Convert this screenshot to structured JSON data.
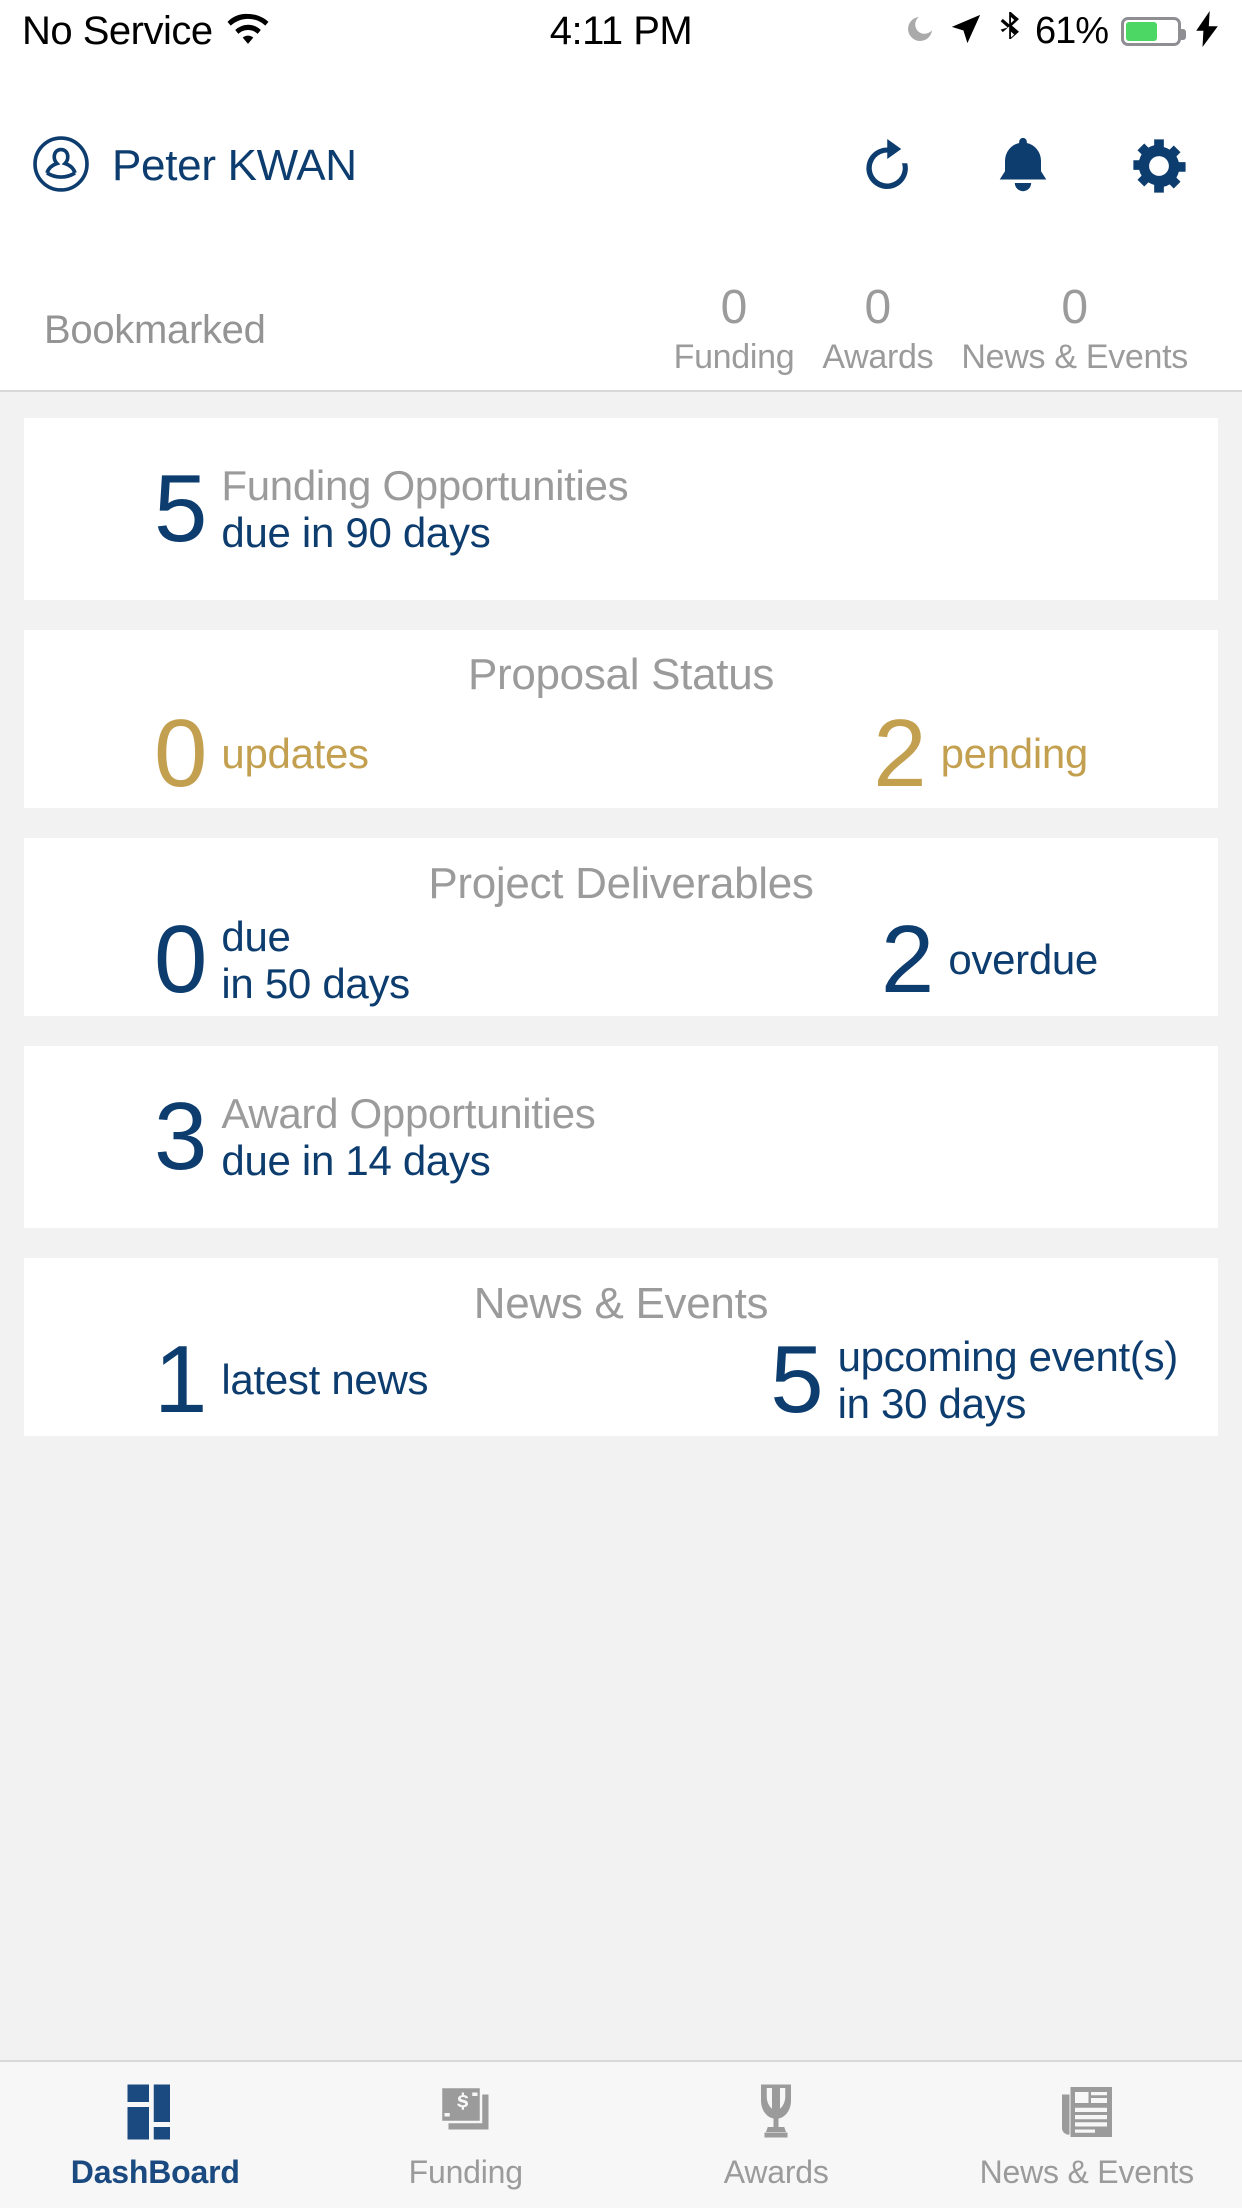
{
  "status_bar": {
    "carrier": "No Service",
    "wifi_icon": "wifi-icon",
    "time": "4:11 PM",
    "dnd_icon": "moon-icon",
    "location_icon": "location-arrow-icon",
    "bluetooth_icon": "bluetooth-icon",
    "battery_percent": "61%",
    "battery_level": 61,
    "battery_color": "#4cd764",
    "charging_icon": "lightning-bolt-icon"
  },
  "header": {
    "avatar_icon": "user-circle-icon",
    "user_name": "Peter KWAN",
    "refresh_icon": "refresh-icon",
    "notifications_icon": "bell-icon",
    "settings_icon": "gear-icon",
    "accent_color": "#0d3c6e"
  },
  "bookmark_bar": {
    "label": "Bookmarked",
    "stats": [
      {
        "count": "0",
        "label": "Funding"
      },
      {
        "count": "0",
        "label": "Awards"
      },
      {
        "count": "0",
        "label": "News & Events"
      }
    ]
  },
  "cards": [
    {
      "id": "funding-opportunities",
      "title": "",
      "metrics": [
        {
          "value": "5",
          "label_top": "Funding Opportunities",
          "label_bottom": "due in 90 days",
          "color": "#0d3c6e"
        }
      ]
    },
    {
      "id": "proposal-status",
      "title": "Proposal Status",
      "metrics": [
        {
          "value": "0",
          "label_top": "",
          "label_bottom": "updates",
          "color": "#c3a050"
        },
        {
          "value": "2",
          "label_top": "",
          "label_bottom": "pending",
          "color": "#c3a050"
        }
      ]
    },
    {
      "id": "project-deliverables",
      "title": "Project Deliverables",
      "metrics": [
        {
          "value": "0",
          "label_top": "due",
          "label_bottom": "in 50 days",
          "color": "#0d3c6e"
        },
        {
          "value": "2",
          "label_top": "",
          "label_bottom": "overdue",
          "color": "#0d3c6e"
        }
      ]
    },
    {
      "id": "award-opportunities",
      "title": "",
      "metrics": [
        {
          "value": "3",
          "label_top": "Award Opportunities",
          "label_bottom": "due in 14 days",
          "color": "#0d3c6e"
        }
      ]
    },
    {
      "id": "news-events",
      "title": "News & Events",
      "metrics": [
        {
          "value": "1",
          "label_top": "",
          "label_bottom": "latest news",
          "color": "#0d3c6e"
        },
        {
          "value": "5",
          "label_top": "upcoming event(s)",
          "label_bottom": "in 30 days",
          "color": "#0d3c6e"
        }
      ]
    }
  ],
  "tab_bar": {
    "active": "DashBoard",
    "tabs": [
      {
        "label": "DashBoard",
        "icon": "dashboard-grid-icon",
        "active": true
      },
      {
        "label": "Funding",
        "icon": "money-document-icon",
        "active": false
      },
      {
        "label": "Awards",
        "icon": "trophy-icon",
        "active": false
      },
      {
        "label": "News & Events",
        "icon": "newspaper-icon",
        "active": false
      }
    ]
  }
}
